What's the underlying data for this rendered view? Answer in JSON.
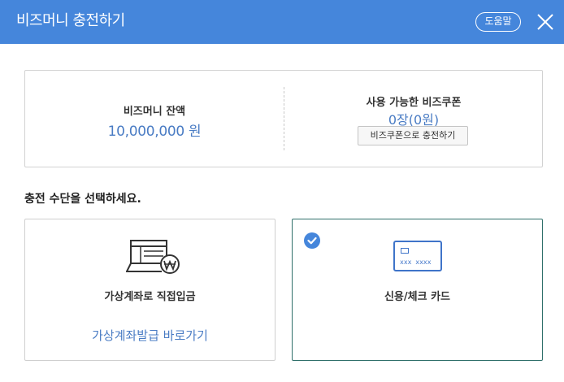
{
  "header": {
    "title": "비즈머니 충전하기",
    "help_label": "도움말",
    "accent_color": "#4586db"
  },
  "balance": {
    "label": "비즈머니 잔액",
    "value": "10,000,000 원"
  },
  "coupon": {
    "label": "사용 가능한 비즈쿠폰",
    "value": "0장(0원)",
    "button_label": "비즈쿠폰으로 충전하기"
  },
  "section": {
    "title": "충전 수단을 선택하세요."
  },
  "options": [
    {
      "label": "가상계좌로 직접입금",
      "link": "가상계좌발급 바로가기",
      "icon": "virtual-account-icon",
      "selected": false
    },
    {
      "label": "신용/체크 카드",
      "card_number_text": "xxx xxxx",
      "icon": "credit-card-icon",
      "selected": true
    }
  ]
}
